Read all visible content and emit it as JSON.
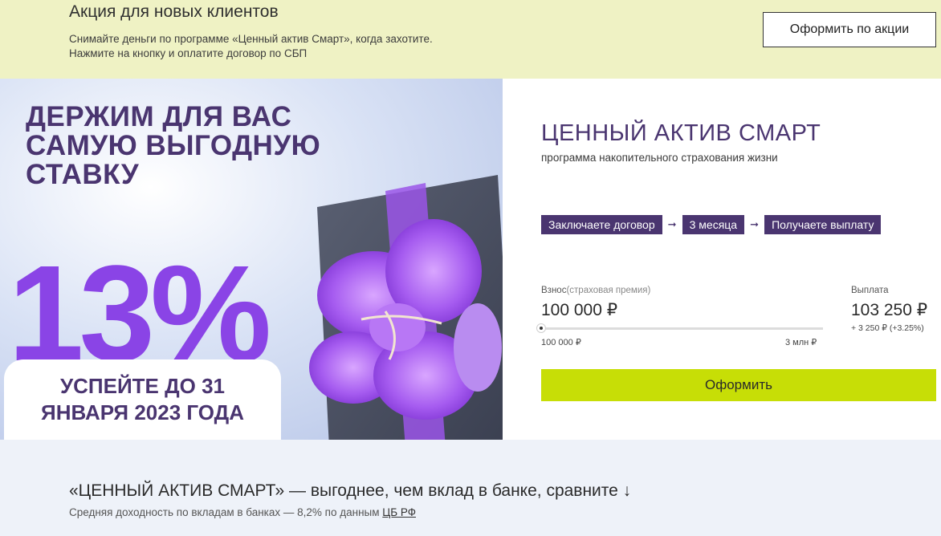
{
  "promo": {
    "title": "Акция для новых клиентов",
    "line1": "Снимайте деньги по программе «Ценный актив Смарт», когда захотите.",
    "line2": "Нажмите на кнопку и оплатите договор по СБП",
    "button": "Оформить по акции"
  },
  "banner": {
    "headline_1": "ДЕРЖИМ ДЛЯ ВАС",
    "headline_2": "САМУЮ ВЫГОДНУЮ",
    "headline_3": "СТАВКУ",
    "rate": "13%",
    "deadline_1": "УСПЕЙТЕ ДО 31",
    "deadline_2": "ЯНВАРЯ 2023 ГОДА"
  },
  "product": {
    "title": "ЦЕННЫЙ АКТИВ СМАРТ",
    "subtitle": "программа накопительного страхования жизни",
    "steps": [
      "Заключаете договор",
      "3 месяца",
      "Получаете выплату"
    ],
    "arrow": "➞",
    "contribution_label": "Взнос",
    "contribution_hint": "(страховая премия)",
    "contribution_value": "100 000 ₽",
    "slider_min": "100 000 ₽",
    "slider_max": "3 млн ₽",
    "slider_fraction": 0.0,
    "payout_label": "Выплата",
    "payout_value": "103 250 ₽",
    "payout_diff": "+ 3 250 ₽ (+3.25%)",
    "submit": "Оформить"
  },
  "compare": {
    "title": "«ЦЕННЫЙ АКТИВ СМАРТ» — выгоднее, чем вклад в банке, сравните ↓",
    "note": "Средняя доходность по вкладам в банках — 8,2% по данным",
    "link": "ЦБ РФ"
  },
  "colors": {
    "brand_purple": "#4a3570",
    "accent_violet": "#8a44e6",
    "cta_lime": "#c7de06",
    "promo_bg": "#eff2c4"
  }
}
